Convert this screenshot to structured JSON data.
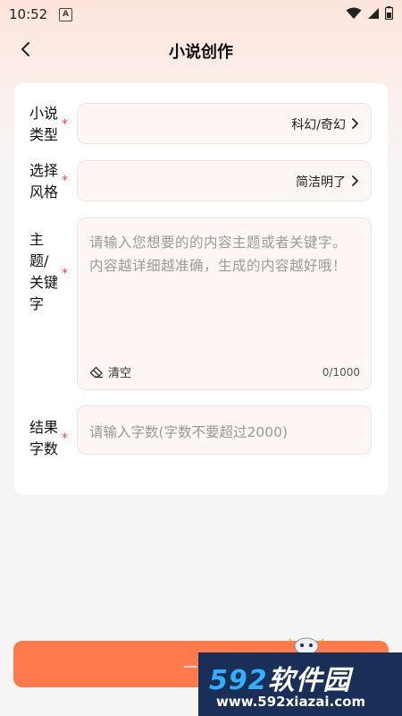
{
  "status_bar": {
    "time": "10:52",
    "indicator": "A"
  },
  "header": {
    "title": "小说创作"
  },
  "form": {
    "type": {
      "label_line1": "小说",
      "label_line2": "类型",
      "required": "*",
      "value": "科幻/奇幻"
    },
    "style": {
      "label_line1": "选择",
      "label_line2": "风格",
      "required": "*",
      "value": "简洁明了"
    },
    "topic": {
      "label_lines": [
        "主",
        "题/",
        "关键",
        "字"
      ],
      "required": "*",
      "placeholder": "请输入您想要的的内容主题或者关键字。内容越详细越准确，生成的内容越好哦！",
      "clear_label": "清空",
      "counter": "0/1000"
    },
    "word_count": {
      "label_line1": "结果",
      "label_line2": "字数",
      "required": "*",
      "placeholder": "请输入字数(字数不要超过2000)"
    }
  },
  "submit": {
    "label": "一键"
  },
  "watermark": {
    "main_text": "软件园",
    "main_number": "592",
    "url": "www.592xiazai.com"
  },
  "icons": {
    "back": "chevron-left-icon",
    "select_arrow": "chevron-right-icon",
    "clear": "eraser-icon",
    "wifi": "wifi-icon",
    "signal": "signal-icon",
    "battery": "battery-icon"
  },
  "colors": {
    "accent": "#ff7a4d",
    "required": "#e84a4a",
    "field_bg": "#fdf6f4"
  }
}
